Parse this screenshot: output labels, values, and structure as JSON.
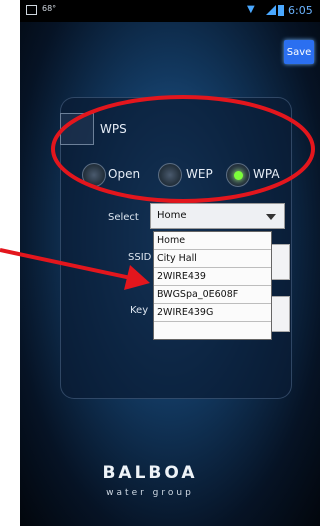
{
  "status_bar": {
    "left_text": "68°",
    "time": "6:05"
  },
  "toolbar": {
    "save_label": "Save"
  },
  "wps": {
    "label": "WPS",
    "checked": false
  },
  "security": {
    "options": [
      {
        "label": "Open",
        "selected": false
      },
      {
        "label": "WEP",
        "selected": false
      },
      {
        "label": "WPA",
        "selected": true
      }
    ]
  },
  "network": {
    "select_label": "Select",
    "selected_value": "Home",
    "ssid_label": "SSID",
    "key_label": "Key",
    "options": [
      "Home",
      "City Hall",
      "2WIRE439",
      "BWGSpa_0E608F",
      "2WIRE439G"
    ]
  },
  "brand": {
    "logo": "BALBOA",
    "tagline": "water group"
  },
  "annotation": {
    "color": "#e3161d"
  }
}
